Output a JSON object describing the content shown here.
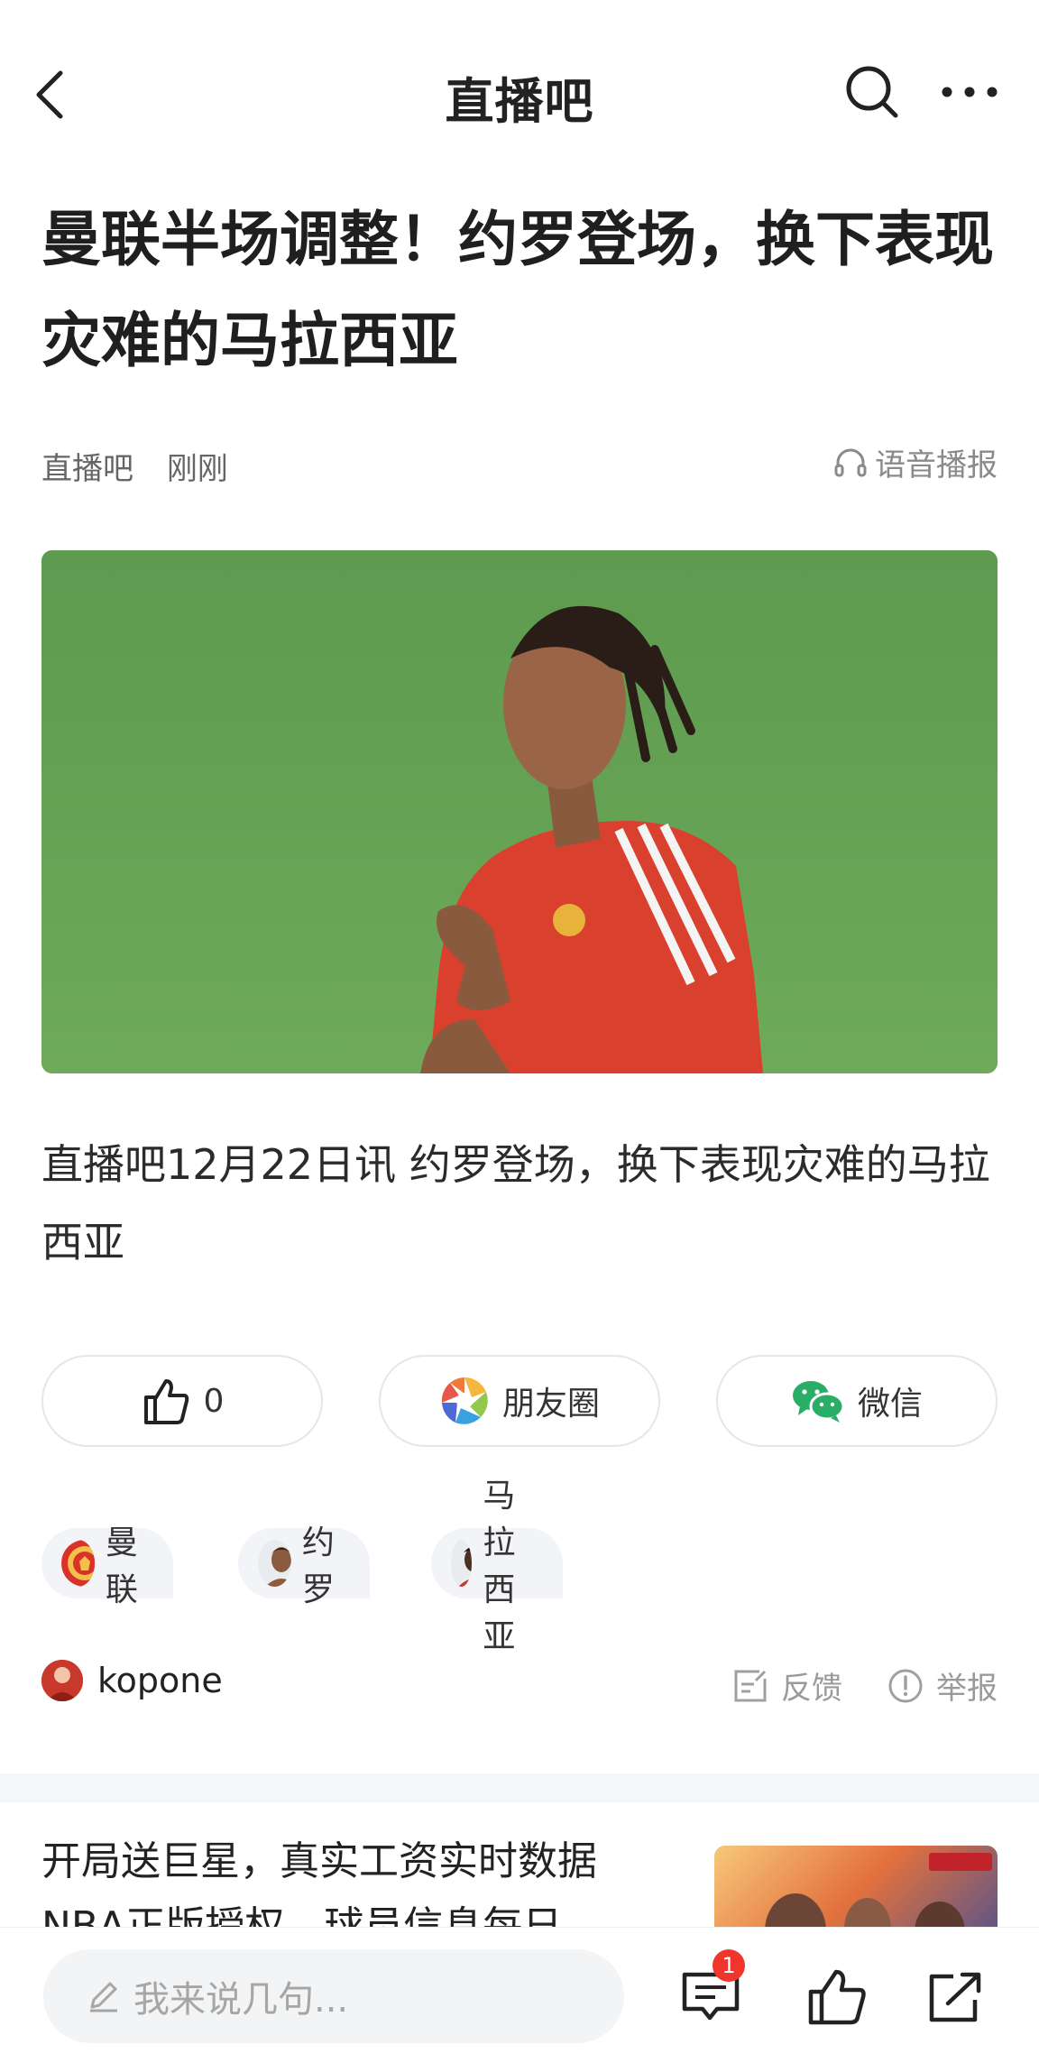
{
  "nav": {
    "title": "直播吧"
  },
  "article": {
    "headline": "曼联半场调整！约罗登场，换下表现灾难的马拉西亚",
    "source": "直播吧",
    "time": "刚刚",
    "voice_label": "语音播报",
    "lead": "直播吧12月22日讯 约罗登场，换下表现灾难的马拉西亚"
  },
  "share": {
    "like_count": "0",
    "moments_label": "朋友圈",
    "wechat_label": "微信"
  },
  "tags": [
    {
      "label": "曼联"
    },
    {
      "label": "约罗"
    },
    {
      "label": "马拉西亚"
    }
  ],
  "author": {
    "name": "kopone",
    "feedback_label": "反馈",
    "report_label": "举报"
  },
  "recommend": {
    "text": "开局送巨星，真实工资实时数据NBA正版授权，球员信息每日"
  },
  "bottom": {
    "comment_placeholder": "我来说几句...",
    "comment_badge": "1"
  },
  "colors": {
    "accent_green": "#2aae67",
    "badge_red": "#f0352c"
  }
}
